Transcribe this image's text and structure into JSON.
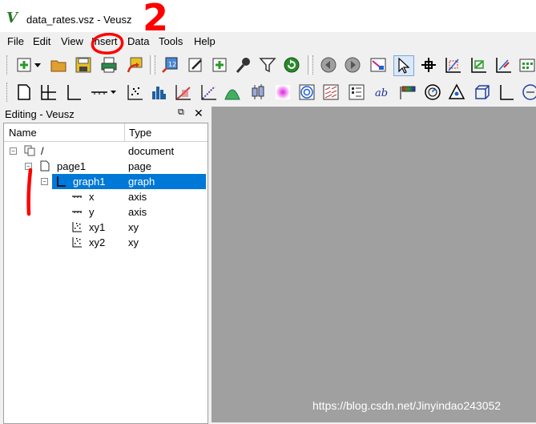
{
  "window": {
    "title": "data_rates.vsz - Veusz",
    "logo": "V"
  },
  "menu": [
    "File",
    "Edit",
    "View",
    "Insert",
    "Data",
    "Tools",
    "Help"
  ],
  "toolbar1_icons": [
    "new-document-icon",
    "dropdown-arrow-icon",
    "open-folder-icon",
    "save-icon",
    "print-icon",
    "export-icon",
    "import-data-icon",
    "edit-data-icon",
    "create-dataset-icon",
    "capture-data-icon",
    "filter-data-icon",
    "reload-data-icon",
    "previous-page-icon",
    "next-page-icon",
    "zoom-graph-icon",
    "select-pointer-icon",
    "pick-point-icon",
    "zoom-axes-icon",
    "zoom-in-icon",
    "zoom-out-icon",
    "full-page-icon"
  ],
  "toolbar2_icons": [
    "page-icon",
    "grid-icon",
    "graph-icon",
    "axis-icon",
    "xy-icon",
    "bar-icon",
    "fit-icon",
    "function-icon",
    "boxplot-icon",
    "image-icon",
    "contour-icon",
    "vectorfield-icon",
    "key-icon",
    "label-icon",
    "colorbar-icon",
    "polar-icon",
    "ternary-icon",
    "3d-scene-icon",
    "line-icon",
    "ellipse-icon"
  ],
  "panel": {
    "title": "Editing - Veusz",
    "columns": {
      "name": "Name",
      "type": "Type"
    },
    "rows": [
      {
        "name": "/",
        "type": "document",
        "icon": "document-root-icon"
      },
      {
        "name": "page1",
        "type": "page",
        "icon": "page-icon"
      },
      {
        "name": "graph1",
        "type": "graph",
        "icon": "graph-icon"
      },
      {
        "name": "x",
        "type": "axis",
        "icon": "axis-icon"
      },
      {
        "name": "y",
        "type": "axis",
        "icon": "axis-icon"
      },
      {
        "name": "xy1",
        "type": "xy",
        "icon": "xy-icon"
      },
      {
        "name": "xy2",
        "type": "xy",
        "icon": "xy-icon"
      }
    ],
    "selected": "graph1"
  },
  "annotations": {
    "number": "2"
  },
  "watermark": "https://blog.csdn.net/Jinyindao243052",
  "colors": {
    "selection": "#0078d7",
    "canvas": "#a0a0a0",
    "annotation": "#ff0000"
  }
}
